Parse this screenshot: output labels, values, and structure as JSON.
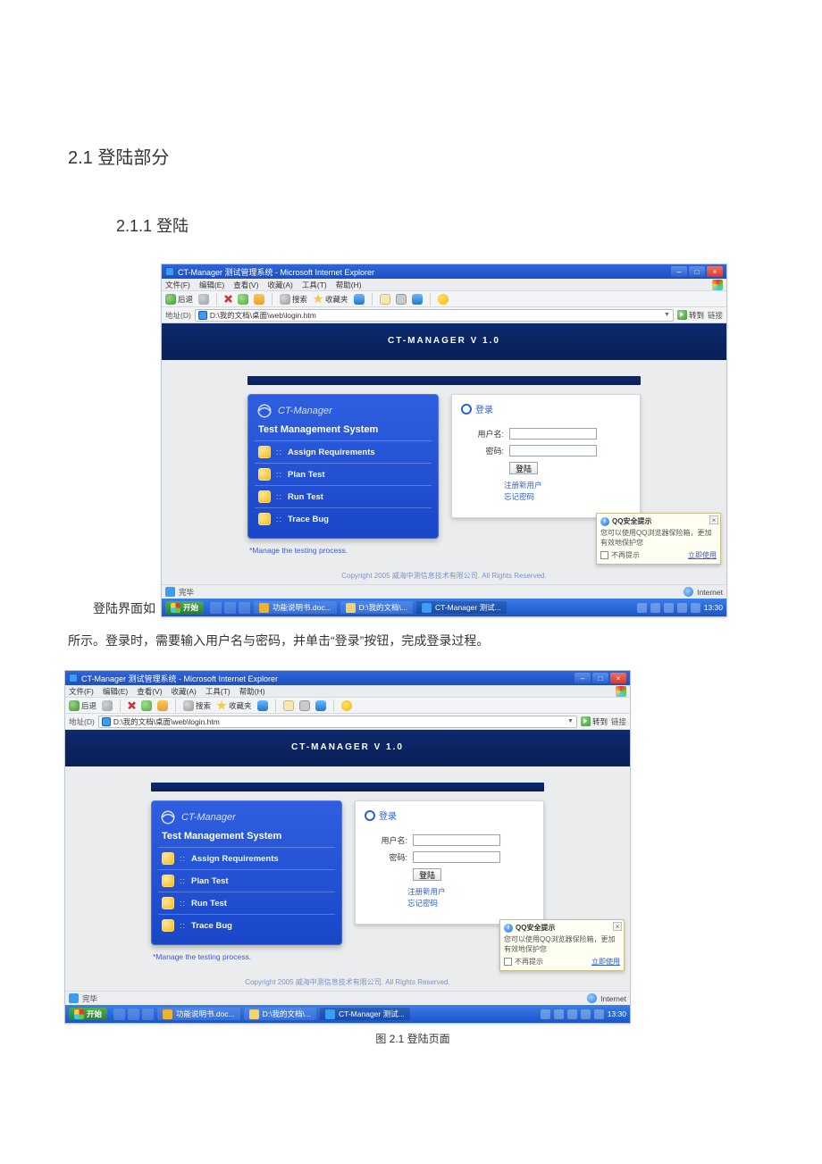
{
  "headings": {
    "h1": "2.1 登陆部分",
    "h2": "2.1.1 登陆"
  },
  "lead_in": "登陆界面如",
  "paragraph": "所示。登录时，需要输入用户名与密码，并单击“登录”按钮，完成登录过程。",
  "caption": "图 2.1 登陆页面",
  "ie": {
    "title": "CT-Manager 测试管理系统 - Microsoft Internet Explorer",
    "menu": [
      "文件(F)",
      "编辑(E)",
      "查看(V)",
      "收藏(A)",
      "工具(T)",
      "帮助(H)"
    ],
    "toolbar": {
      "search": "搜索",
      "fav": "收藏夹"
    },
    "addr_label": "地址(D)",
    "address": "D:\\我的文档\\桌面\\web\\login.htm",
    "go": "转到",
    "links": "链接",
    "status_done": "完毕",
    "status_zone": "Internet"
  },
  "app": {
    "header": "CT-MANAGER V 1.0",
    "brand": "CT-Manager",
    "subtitle": "Test Management System",
    "items": [
      "Assign Requirements",
      "Plan Test",
      "Run Test",
      "Trace Bug"
    ],
    "footnote": "*Manage the testing process.",
    "copyright": "Copyright 2005 威海中测信息技术有限公司. All Rights Reserved."
  },
  "login": {
    "title": "登录",
    "user_label": "用户名:",
    "pass_label": "密码:",
    "button": "登陆",
    "link_register": "注册新用户",
    "link_forgot": "忘记密码"
  },
  "popup": {
    "title": "QQ安全提示",
    "body": "您可以使用QQ浏览器保险箱，更加有效地保护您",
    "nohint": "不再提示",
    "learn": "立即使用"
  },
  "taskbar": {
    "start": "开始",
    "tasks": [
      "功能说明书.doc...",
      "D:\\我的文档\\...",
      "CT-Manager 测试..."
    ],
    "clock": "13:30"
  }
}
